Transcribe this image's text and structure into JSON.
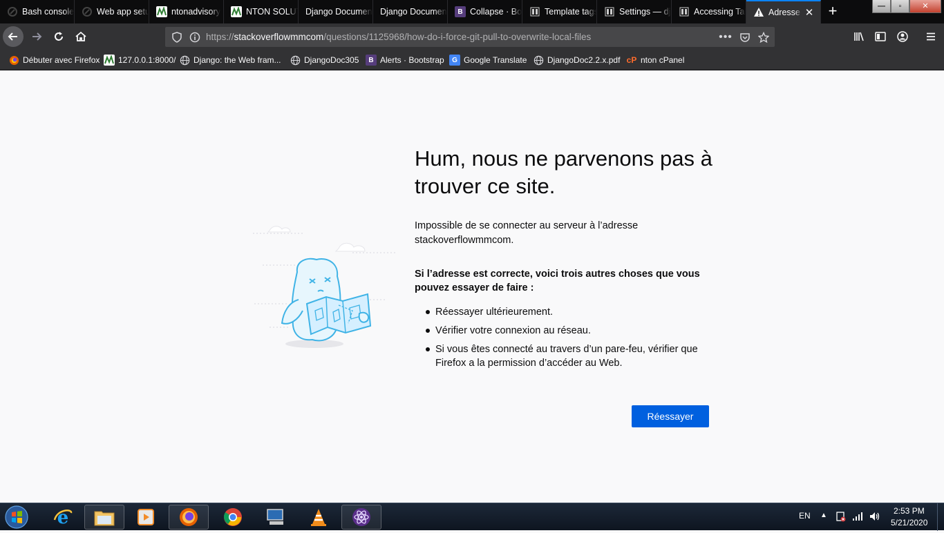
{
  "tabs": [
    {
      "label": "Bash console",
      "icon": "pythonanywhere-icon",
      "color": "#1a1a1a"
    },
    {
      "label": "Web app setup",
      "icon": "pythonanywhere-icon",
      "color": "#1a1a1a"
    },
    {
      "label": "ntonadvisory",
      "icon": "nton-icon",
      "color": "#2e7d32"
    },
    {
      "label": "NTON SOLUTIONS",
      "icon": "nton-icon",
      "color": "#2e7d32"
    },
    {
      "label": "Django Documentation",
      "icon": "",
      "color": ""
    },
    {
      "label": "Django Documentation",
      "icon": "",
      "color": ""
    },
    {
      "label": "Collapse · Bootstrap",
      "icon": "bootstrap-icon",
      "color": "#563d7c"
    },
    {
      "label": "Template tags",
      "icon": "doc-icon",
      "color": "#888"
    },
    {
      "label": "Settings — django",
      "icon": "doc-icon",
      "color": "#888"
    },
    {
      "label": "Accessing Tables",
      "icon": "doc-icon",
      "color": "#888"
    },
    {
      "label": "Adresse introuvable",
      "icon": "warning-icon",
      "color": "#fff"
    }
  ],
  "url": {
    "host": "stackoverflowmmcom",
    "prefix": "https://",
    "path": "/questions/1125968/how-do-i-force-git-pull-to-overwrite-local-files"
  },
  "bookmarks": [
    {
      "label": "Débuter avec Firefox"
    },
    {
      "label": "127.0.0.1:8000/"
    },
    {
      "label": "Django: the Web fram..."
    },
    {
      "label": "DjangoDoc305"
    },
    {
      "label": "Alerts · Bootstrap"
    },
    {
      "label": "Google Translate"
    },
    {
      "label": "DjangoDoc2.2.x.pdf"
    },
    {
      "label": "nton cPanel"
    }
  ],
  "error": {
    "title": "Hum, nous ne parvenons pas à trouver ce site.",
    "description": "Impossible de se connecter au serveur à l’adresse stackoverflowmmcom.",
    "subtitle": "Si l’adresse est correcte, voici trois autres choses que vous pouvez essayer de faire :",
    "suggestions": [
      "Réessayer ultérieurement.",
      "Vérifier votre connexion au réseau.",
      "Si vous êtes connecté au travers d’un pare-feu, vérifier que Firefox a la permission d’accéder au Web."
    ],
    "retry_label": "Réessayer"
  },
  "taskbar": {
    "language": "EN",
    "time": "2:53 PM",
    "date": "5/21/2020"
  },
  "colors": {
    "accent": "#0a84ff",
    "button": "#0060df"
  }
}
